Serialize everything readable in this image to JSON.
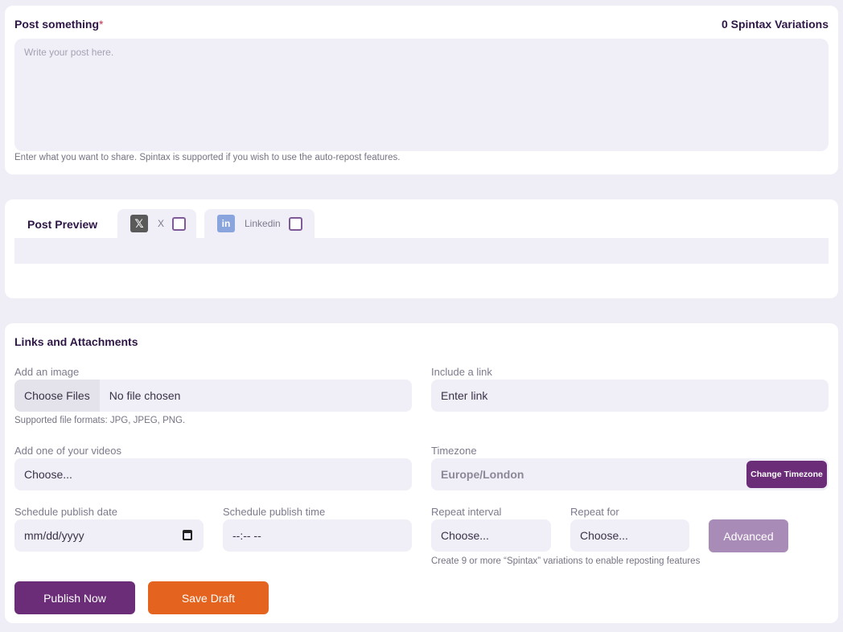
{
  "post": {
    "title": "Post something",
    "required_mark": "*",
    "variations": "0 Spintax Variations",
    "placeholder": "Write your post here.",
    "hint": "Enter what you want to share. Spintax is supported if you wish to use the auto-repost features."
  },
  "preview": {
    "title": "Post Preview",
    "tabs": [
      {
        "label": "X",
        "icon": "x-logo-icon",
        "checked": false
      },
      {
        "label": "Linkedin",
        "icon": "linkedin-logo-icon",
        "checked": false
      }
    ]
  },
  "links": {
    "title": "Links and Attachments",
    "image_label": "Add an image",
    "file_button": "Choose Files",
    "file_status": "No file chosen",
    "file_hint": "Supported file formats: JPG, JPEG, PNG.",
    "link_label": "Include a link",
    "link_placeholder": "Enter link",
    "video_label": "Add one of your videos",
    "video_value": "Choose...",
    "timezone_label": "Timezone",
    "timezone_value": "Europe/London",
    "timezone_button": "Change Timezone",
    "date_label": "Schedule publish date",
    "date_placeholder": "mm/dd/yyyy",
    "time_label": "Schedule publish time",
    "time_placeholder": "--:-- --",
    "interval_label": "Repeat interval",
    "interval_value": "Choose...",
    "repeat_label": "Repeat for",
    "repeat_value": "Choose...",
    "advanced_button": "Advanced",
    "repost_hint": "Create 9 or more “Spintax” variations to enable reposting features",
    "publish_button": "Publish Now",
    "draft_button": "Save Draft"
  },
  "colors": {
    "background": "#efedf6",
    "field": "#f0eef7",
    "brand_purple": "#6b2c78",
    "accent_orange": "#e4631e"
  }
}
